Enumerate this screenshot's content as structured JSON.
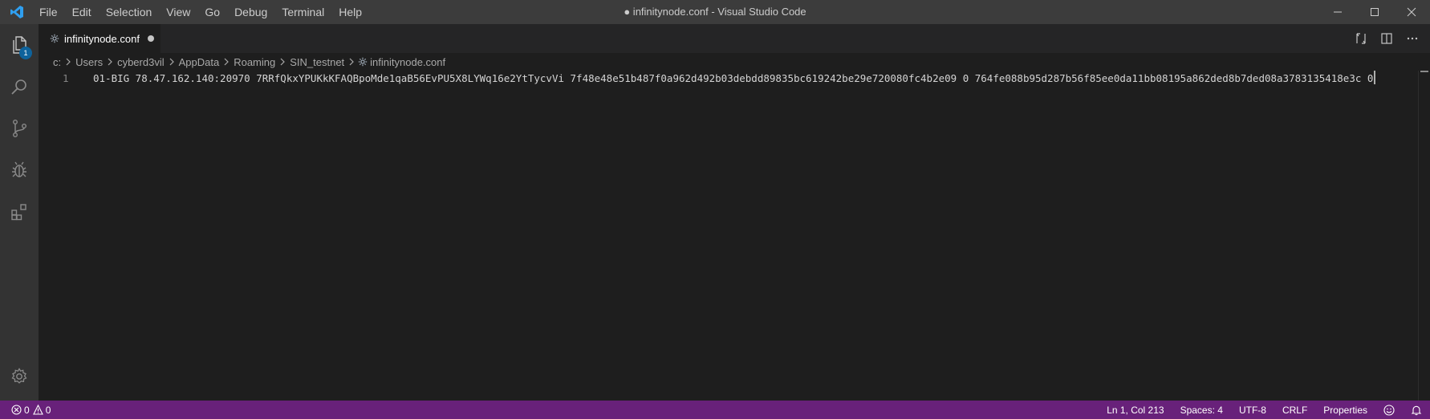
{
  "window": {
    "title": "● infinitynode.conf - Visual Studio Code"
  },
  "menu": [
    "File",
    "Edit",
    "Selection",
    "View",
    "Go",
    "Debug",
    "Terminal",
    "Help"
  ],
  "activity": {
    "explorer_badge": "1"
  },
  "tab": {
    "label": "infinitynode.conf"
  },
  "breadcrumb": [
    "c:",
    "Users",
    "cyberd3vil",
    "AppData",
    "Roaming",
    "SIN_testnet",
    "infinitynode.conf"
  ],
  "editor": {
    "line_number": "1",
    "line_text": "01-BIG 78.47.162.140:20970 7RRfQkxYPUKkKFAQBpoMde1qaB56EvPU5X8LYWq16e2YtTycvVi 7f48e48e51b487f0a962d492b03debdd89835bc619242be29e720080fc4b2e09 0 764fe088b95d287b56f85ee0da11bb08195a862ded8b7ded08a3783135418e3c 0"
  },
  "status": {
    "errors": "0",
    "warnings": "0",
    "position": "Ln 1, Col 213",
    "spaces": "Spaces: 4",
    "encoding": "UTF-8",
    "eol": "CRLF",
    "language": "Properties"
  },
  "colors": {
    "statusbar": "#68217a",
    "accent": "#0e639c",
    "editor_bg": "#1e1e1e"
  }
}
